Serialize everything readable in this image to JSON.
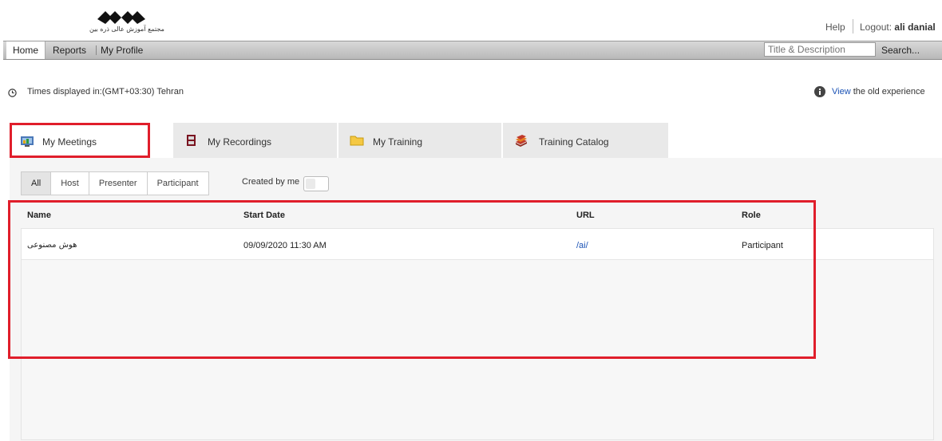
{
  "header": {
    "logo_text": "مجتمع آموزش عالی ذره بین",
    "help_label": "Help",
    "logout_label": "Logout:",
    "user_name": "ali danial"
  },
  "nav": {
    "items": [
      {
        "label": "Home",
        "active": true
      },
      {
        "label": "Reports",
        "active": false
      },
      {
        "label": "My Profile",
        "active": false
      }
    ],
    "search_placeholder": "Title & Description",
    "search_button": "Search..."
  },
  "timezone_text": "Times displayed in:(GMT+03:30) Tehran",
  "old_experience": {
    "link": "View",
    "text": " the old experience"
  },
  "tabs": [
    {
      "label": "My Meetings",
      "icon": "meetings-icon",
      "active": true
    },
    {
      "label": "My Recordings",
      "icon": "recordings-icon",
      "active": false
    },
    {
      "label": "My Training",
      "icon": "folder-icon",
      "active": false
    },
    {
      "label": "Training Catalog",
      "icon": "catalog-books-icon",
      "active": false
    }
  ],
  "filters": {
    "options": [
      "All",
      "Host",
      "Presenter",
      "Participant"
    ],
    "selected": "All",
    "created_by_me_label": "Created by me",
    "created_by_me": false
  },
  "table": {
    "columns": [
      "Name",
      "Start Date",
      "URL",
      "Role"
    ],
    "rows": [
      {
        "name": "هوش مصنوعی",
        "start_date": "09/09/2020 11:30 AM",
        "url": "/ai/",
        "role": "Participant"
      }
    ]
  },
  "colors": {
    "highlight_red": "#e01e2b",
    "link_blue": "#1a52b5"
  }
}
